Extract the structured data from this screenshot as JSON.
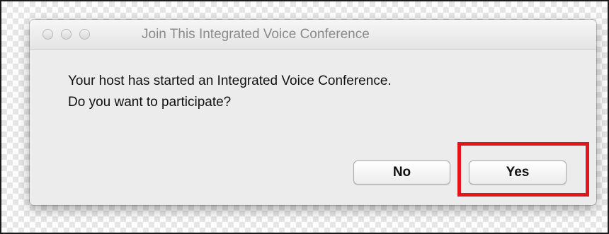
{
  "dialog": {
    "title": "Join This Integrated Voice Conference",
    "message_line1": "Your host has started an Integrated Voice Conference.",
    "message_line2": "Do you want to participate?",
    "buttons": {
      "no_label": "No",
      "yes_label": "Yes"
    }
  },
  "window_controls": [
    "close-icon",
    "minimize-icon",
    "zoom-icon"
  ],
  "colors": {
    "highlight": "#e3141a",
    "dialog_background": "#ececec",
    "title_text": "#8b8b8b"
  }
}
